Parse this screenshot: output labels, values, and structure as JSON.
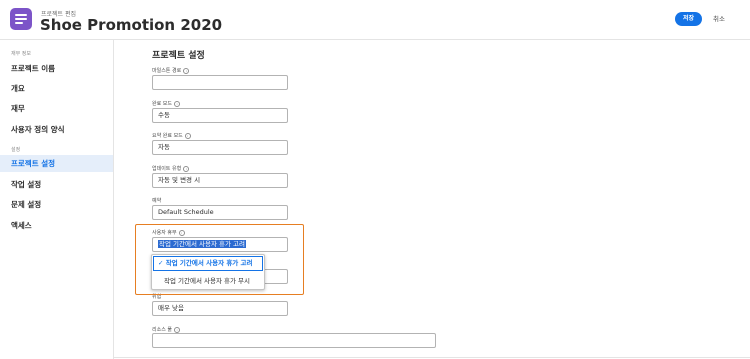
{
  "header": {
    "breadcrumb": "프로젝트 편집",
    "title": "Shoe Promotion 2020",
    "save_label": "저장",
    "cancel_label": "취소"
  },
  "sidebar": {
    "section1": "재무 정보",
    "section2": "설정",
    "items": [
      {
        "label": "프로젝트 이름"
      },
      {
        "label": "개요"
      },
      {
        "label": "재무"
      },
      {
        "label": "사용자 정의 양식"
      },
      {
        "label": "프로젝트 설정"
      },
      {
        "label": "작업 설정"
      },
      {
        "label": "문제 설정"
      },
      {
        "label": "액세스"
      }
    ],
    "active": "프로젝트 설정"
  },
  "main": {
    "title": "프로젝트 설정",
    "fields": [
      {
        "label": "마일스톤 경로",
        "value": ""
      },
      {
        "label": "완료 모드",
        "value": "수동"
      },
      {
        "label": "요약 완료 모드",
        "value": "자동"
      },
      {
        "label": "업데이트 유형",
        "value": "자동 및 변경 시"
      },
      {
        "label": "예약",
        "value": "Default Schedule"
      },
      {
        "label": "사용자 휴무",
        "value": "작업 기간에서 사용자 휴가 고려"
      },
      {
        "label": "위험",
        "value": "매우 낮음"
      },
      {
        "label": "리소스 풀",
        "value": ""
      }
    ],
    "dropdown": {
      "options": [
        "✓ 작업 기간에서 사용자 휴가 고려",
        "작업 기간에서 사용자 휴가 무시"
      ]
    }
  },
  "colors": {
    "accent": "#1473e6",
    "app_icon": "#7c54c8",
    "highlight": "#e67e22"
  }
}
